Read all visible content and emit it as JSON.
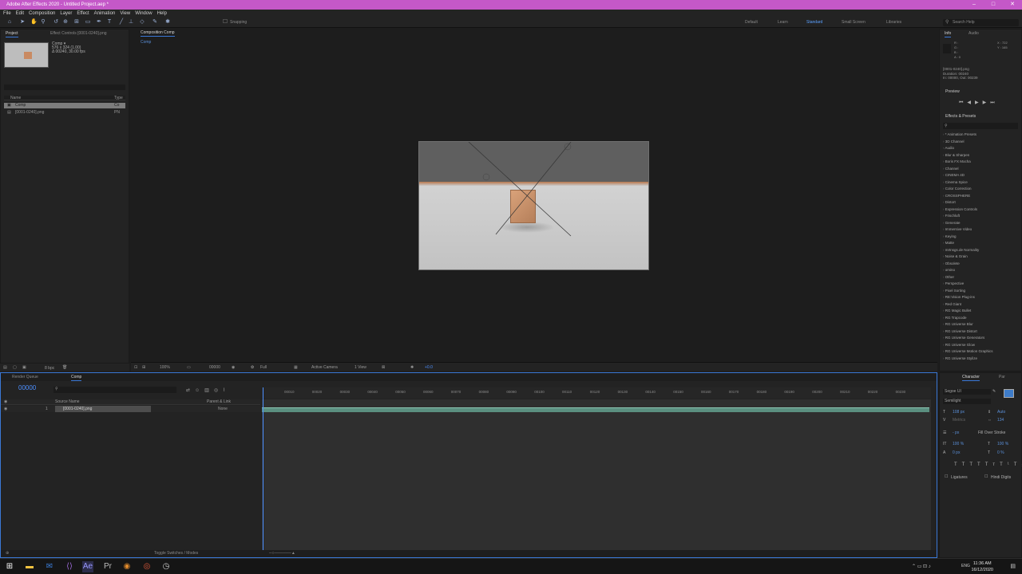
{
  "app": {
    "title": "Adobe After Effects 2020 - Untitled Project.aep *"
  },
  "menu": [
    "File",
    "Edit",
    "Composition",
    "Layer",
    "Effect",
    "Animation",
    "View",
    "Window",
    "Help"
  ],
  "toolbar": {
    "snapping_label": "Snapping",
    "workspaces": [
      "Default",
      "Learn",
      "Standard",
      "Small Screen",
      "Libraries"
    ],
    "active_workspace": "Standard",
    "search_placeholder": "Search Help"
  },
  "project": {
    "tab_project": "Project",
    "tab_effect_controls": "Effect Controls [0001-0240].png",
    "comp_name": "Comp ▾",
    "comp_size": "576 x 324 (1.00)",
    "comp_duration": "Δ 00240, 30.00 fps",
    "col_name": "Name",
    "col_type": "Type",
    "items": [
      {
        "name": "Comp",
        "type": "Co"
      },
      {
        "name": "[0001-0240].png",
        "type": "PN"
      }
    ],
    "bpc": "8 bpc"
  },
  "viewer": {
    "tab": "Composition Comp",
    "comp_label": "Comp",
    "zoom": "100%",
    "timecode": "00000",
    "resolution": "Full",
    "camera": "Active Camera",
    "views": "1 View",
    "exposure": "+0.0"
  },
  "right": {
    "tab_info": "Info",
    "tab_audio": "Audio",
    "info_rgba": [
      "R :",
      "G :",
      "B :",
      "A : 0"
    ],
    "info_xy": [
      "X : 722",
      "Y : 165"
    ],
    "info_file": "[0001-0240].png",
    "info_duration": "Duration: 00240",
    "info_inout": "In: 00000, Out: 00239",
    "preview_label": "Preview",
    "effects_label": "Effects & Presets",
    "effects": [
      "* Animation Presets",
      "3D Channel",
      "Audio",
      "Blur & Sharpen",
      "Boris FX Mocha",
      "Channel",
      "CINEMA 4D",
      "Cinema Spice",
      "Color Correction",
      "CROSSPHERE",
      "Distort",
      "Expression Controls",
      "Frischluft",
      "Generate",
      "Immersive Video",
      "Keying",
      "Matte",
      "mrtnsgs.de Normality",
      "Noise & Grain",
      "Obsolete",
      "omino",
      "Other",
      "Perspective",
      "Pixel Sorting",
      "RE:Vision Plug-ins",
      "Red Giant",
      "RG Magic Bullet",
      "RG Trapcode",
      "RG Universe Blur",
      "RG Universe Distort",
      "RG Universe Generators",
      "RG Universe Glow",
      "RG Universe Motion Graphics",
      "RG Universe Stylize"
    ]
  },
  "timeline": {
    "tab_render": "Render Queue",
    "tab_comp": "Comp",
    "timecode": "00000",
    "col_source": "Source Name",
    "col_parent": "Parent & Link",
    "layer_index": "1",
    "layer_name": "[0001-0240].png",
    "layer_parent": "None",
    "ticks": [
      "00010",
      "00020",
      "00030",
      "00040",
      "00050",
      "00060",
      "00070",
      "00080",
      "00090",
      "00100",
      "00110",
      "00120",
      "00130",
      "00140",
      "00150",
      "00160",
      "00170",
      "00180",
      "00190",
      "00200",
      "00210",
      "00220",
      "00230"
    ],
    "toggle_label": "Toggle Switches / Modes"
  },
  "character": {
    "tab": "Character",
    "tab_par": "Par",
    "font": "Segoe UI",
    "style": "Semilight",
    "size": "108 px",
    "leading": "Auto",
    "kerning": "Metrics",
    "tracking": "134",
    "stroke_width": "- px",
    "stroke_type": "Fill Over Stroke",
    "vscale": "100 %",
    "hscale": "100 %",
    "baseline": "0 px",
    "tsume": "0 %",
    "ligatures": "Ligatures",
    "hindi": "Hindi Digits"
  },
  "taskbar": {
    "time": "11:36 AM",
    "date": "16/12/2020",
    "lang": "ENG"
  }
}
